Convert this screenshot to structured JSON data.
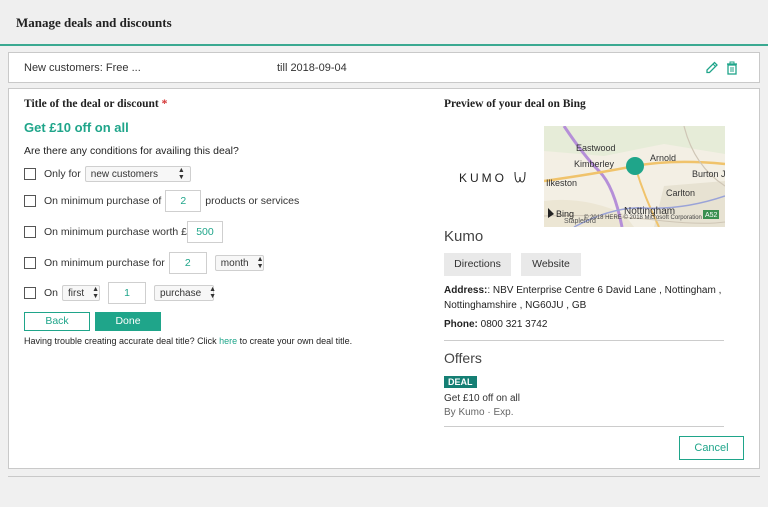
{
  "header": {
    "title": "Manage deals and discounts"
  },
  "deal_row": {
    "name": "New customers: Free ...",
    "till": "till 2018-09-04",
    "edit_icon": "pencil-icon",
    "delete_icon": "trash-icon"
  },
  "form": {
    "title_label": "Title of the deal or discount",
    "required_mark": "*",
    "deal_title": "Get £10 off on all",
    "question": "Are there any conditions for availing this deal?",
    "cond_only_for": {
      "label": "Only for",
      "select": "new customers"
    },
    "cond_min_products": {
      "label": "On minimum purchase of",
      "value": "2",
      "suffix": "products or services"
    },
    "cond_min_worth": {
      "label": "On minimum purchase worth £",
      "value": "500"
    },
    "cond_min_for": {
      "label": "On minimum purchase for",
      "value": "2",
      "select": "month"
    },
    "cond_on": {
      "label": "On",
      "select1": "first",
      "value": "1",
      "select2": "purchase"
    },
    "back_label": "Back",
    "done_label": "Done",
    "help_prefix": "Having trouble creating accurate deal title? Click ",
    "help_link": "here",
    "help_suffix": " to create your own deal title."
  },
  "preview": {
    "title": "Preview of your deal on Bing",
    "logo_text": "KUMO",
    "map": {
      "labels": [
        "Eastwood",
        "Arnold",
        "Kimberley",
        "Ilkeston",
        "Burton J",
        "Carlton",
        "Nottingham",
        "Stapleford",
        "A52"
      ],
      "attribution": "© 2018 HERE © 2018 Microsoft Corporation",
      "provider": "Bing"
    },
    "business_name": "Kumo",
    "directions_label": "Directions",
    "website_label": "Website",
    "address_label": "Address:",
    "address_value": ": NBV Enterprise Centre 6 David Lane , Nottingham ,",
    "address_line2": "Nottinghamshire , NG60JU , GB",
    "phone_label": "Phone:",
    "phone_value": " 0800 321 3742",
    "offers_heading": "Offers",
    "deal_badge": "DEAL",
    "offer_text": "Get £10 off on all",
    "offer_by": "By Kumo · Exp.",
    "cancel_label": "Cancel"
  },
  "colors": {
    "accent": "#1fa58a",
    "badge": "#157f74",
    "required": "#d43131"
  }
}
